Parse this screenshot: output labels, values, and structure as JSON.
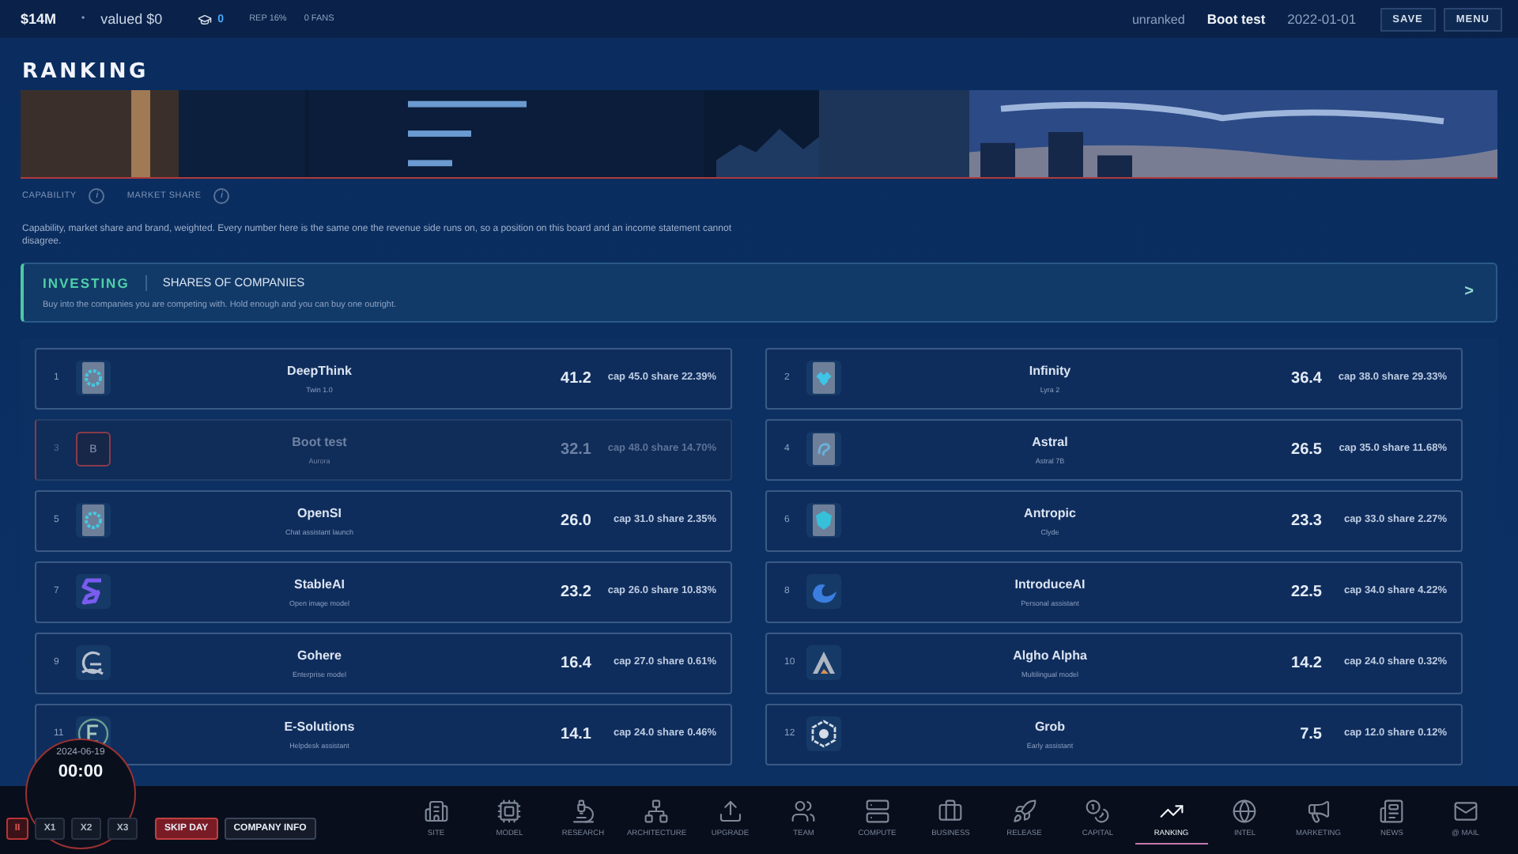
{
  "top_bar": {
    "cash": "$14M",
    "separator": "•",
    "valuation": "valued $0",
    "research_points": "0",
    "reputation": "REP 16%",
    "fans": "0 FANS",
    "rank_status": "unranked",
    "company": "Boot test",
    "date": "2022-01-01",
    "buttons": [
      "SAVE",
      "MENU"
    ]
  },
  "page": {
    "title": "RANKING",
    "legend": [
      {
        "label": "CAPABILITY",
        "info": "i"
      },
      {
        "label": "MARKET SHARE",
        "info": "i"
      }
    ],
    "description": "Capability, market share and brand, weighted. Every number here is the same one the revenue side runs on, so a position on this board and an income statement cannot disagree."
  },
  "investing": {
    "tag": "INVESTING",
    "title": "SHARES OF COMPANIES",
    "text": "Buy into the companies you are competing with. Hold enough and you can buy one outright.",
    "arrow": ">"
  },
  "rows": [
    {
      "kind": "rival",
      "rank": "1",
      "name": "DeepThink",
      "model": "Twin 1.0",
      "score": "41.2",
      "stats": "cap 45.0 share 22.39%"
    },
    {
      "kind": "rival",
      "rank": "2",
      "name": "Infinity",
      "model": "Lyra 2",
      "score": "36.4",
      "stats": "cap 38.0 share 29.33%"
    },
    {
      "kind": "player",
      "rank": "3",
      "letter": "B",
      "name": "Boot test",
      "model": "Aurora",
      "score": "32.1",
      "stats": "cap 48.0 share 14.70%"
    },
    {
      "kind": "rival",
      "rank": "4",
      "name": "Astral",
      "model": "Astral 7B",
      "score": "26.5",
      "stats": "cap 35.0 share 11.68%"
    },
    {
      "kind": "rival",
      "rank": "5",
      "name": "OpenSI",
      "model": "Chat assistant launch",
      "score": "26.0",
      "stats": "cap 31.0 share 2.35%"
    },
    {
      "kind": "rival",
      "rank": "6",
      "name": "Antropic",
      "model": "Clyde",
      "score": "23.3",
      "stats": "cap 33.0 share 2.27%"
    },
    {
      "kind": "rival",
      "rank": "7",
      "name": "StableAI",
      "model": "Open image model",
      "score": "23.2",
      "stats": "cap 26.0 share 10.83%"
    },
    {
      "kind": "rival",
      "rank": "8",
      "name": "IntroduceAI",
      "model": "Personal assistant",
      "score": "22.5",
      "stats": "cap 34.0 share 4.22%"
    },
    {
      "kind": "rival",
      "rank": "9",
      "name": "Gohere",
      "model": "Enterprise model",
      "score": "16.4",
      "stats": "cap 27.0 share 0.61%"
    },
    {
      "kind": "rival",
      "rank": "10",
      "name": "Algho Alpha",
      "model": "Multilingual model",
      "score": "14.2",
      "stats": "cap 24.0 share 0.32%"
    },
    {
      "kind": "rival",
      "rank": "11",
      "name": "E-Solutions",
      "model": "Helpdesk assistant",
      "score": "14.1",
      "stats": "cap 24.0 share 0.46%"
    },
    {
      "kind": "rival",
      "rank": "12",
      "name": "Grob",
      "model": "Early assistant",
      "score": "7.5",
      "stats": "cap 12.0 share 0.12%"
    }
  ],
  "clock": {
    "date": "2024-06-19",
    "time": "00:00"
  },
  "speed_controls": [
    {
      "label": "II",
      "kind": "pause",
      "selected": true
    },
    {
      "label": "X1",
      "kind": "speed",
      "selected": false
    },
    {
      "label": "X2",
      "kind": "speed",
      "selected": false
    },
    {
      "label": "X3",
      "kind": "speed",
      "selected": false
    },
    {
      "label": "SKIP DAY",
      "kind": "action",
      "selected": true
    },
    {
      "label": "COMPANY INFO",
      "kind": "action",
      "selected": false
    }
  ],
  "nav": [
    {
      "label": "SITE",
      "selected": false
    },
    {
      "label": "MODEL",
      "selected": false
    },
    {
      "label": "RESEARCH",
      "selected": false
    },
    {
      "label": "ARCHITECTURE",
      "selected": false
    },
    {
      "label": "UPGRADE",
      "selected": false
    },
    {
      "label": "TEAM",
      "selected": false
    },
    {
      "label": "COMPUTE",
      "selected": false
    },
    {
      "label": "BUSINESS",
      "selected": false
    },
    {
      "label": "RELEASE",
      "selected": false
    },
    {
      "label": "CAPITAL",
      "selected": false
    },
    {
      "label": "RANKING",
      "selected": true
    },
    {
      "label": "INTEL",
      "selected": false
    },
    {
      "label": "MARKETING",
      "selected": false
    },
    {
      "label": "NEWS",
      "selected": false
    },
    {
      "label": "@ MAIL",
      "selected": false
    }
  ]
}
